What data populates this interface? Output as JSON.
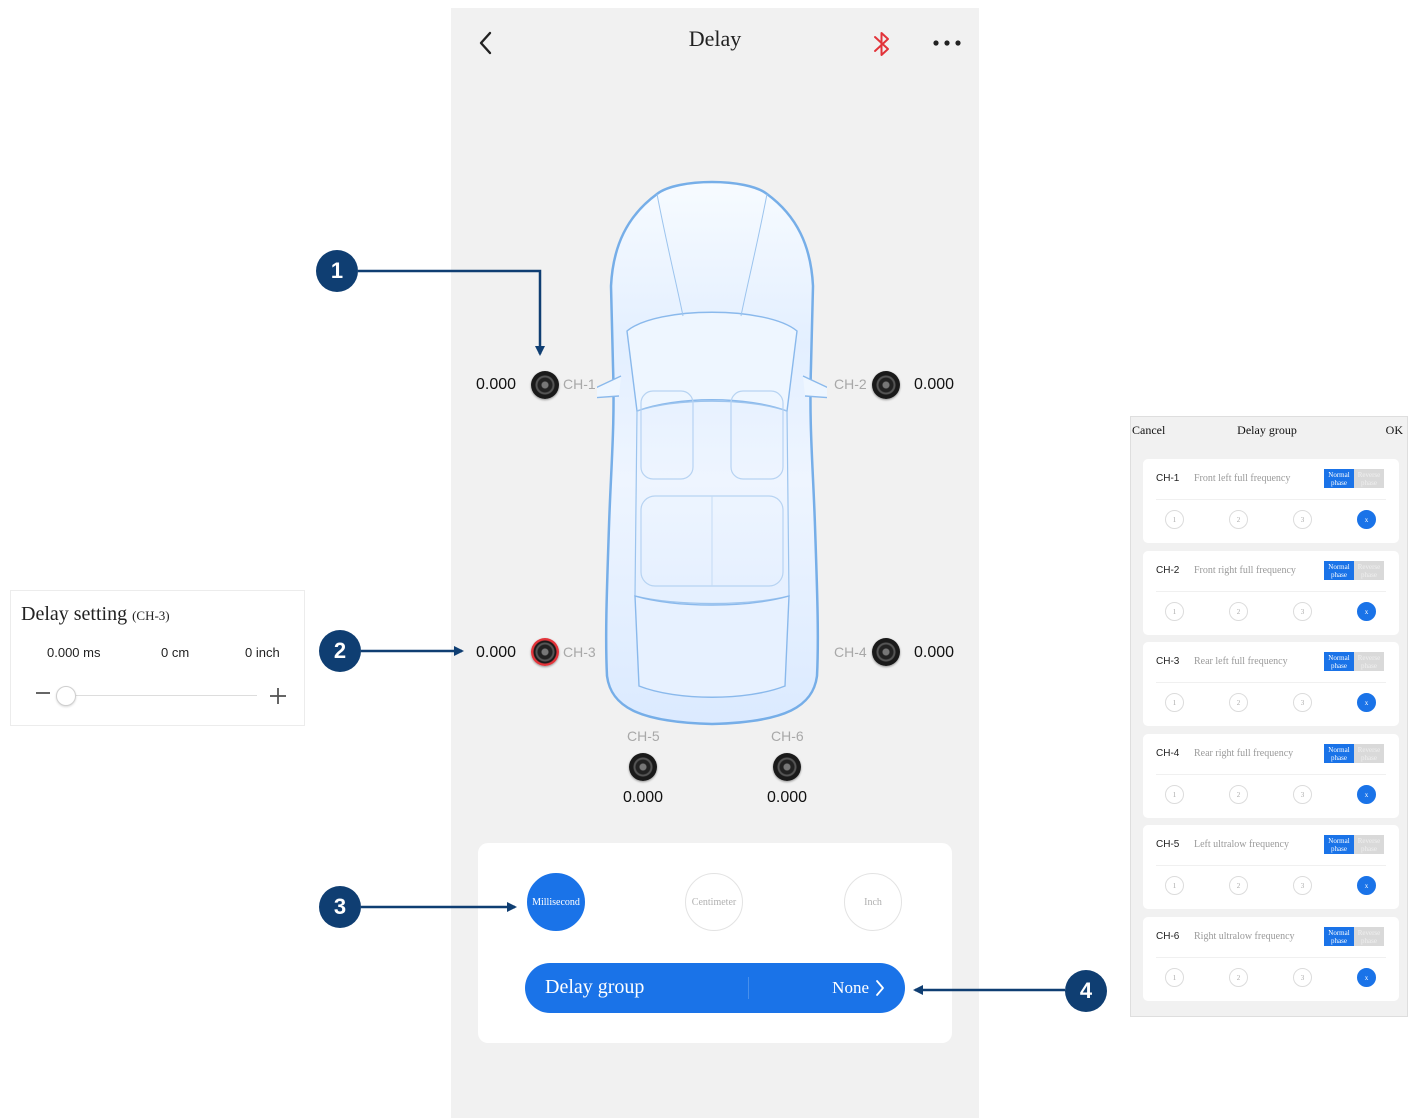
{
  "header": {
    "title": "Delay"
  },
  "icons": {
    "back": "chevron-left-icon",
    "bluetooth": "bluetooth-icon",
    "more": "more-dots-icon"
  },
  "colors": {
    "accent": "#1a73e8",
    "bluetooth": "#e2343a",
    "active_speaker_ring": "#e2343a",
    "callout": "#0f3e72"
  },
  "speakers": [
    {
      "id": "CH-1",
      "value": "0.000"
    },
    {
      "id": "CH-2",
      "value": "0.000"
    },
    {
      "id": "CH-3",
      "value": "0.000",
      "active": true
    },
    {
      "id": "CH-4",
      "value": "0.000"
    },
    {
      "id": "CH-5",
      "value": "0.000"
    },
    {
      "id": "CH-6",
      "value": "0.000"
    }
  ],
  "units": {
    "options": [
      "Millisecond",
      "Centimeter",
      "Inch"
    ],
    "selected": "Millisecond"
  },
  "delay_group": {
    "label": "Delay group",
    "value": "None"
  },
  "callouts": [
    "1",
    "2",
    "3",
    "4"
  ],
  "delay_setting": {
    "title": "Delay setting",
    "channel": "(CH-3)",
    "ms": "0.000 ms",
    "cm": "0 cm",
    "inch": "0 inch",
    "slider_fraction": 0
  },
  "dialog": {
    "cancel": "Cancel",
    "title": "Delay group",
    "ok": "OK",
    "normal_phase": "Normal phase",
    "reverse_phase": "Reverse phase",
    "options": [
      "1",
      "2",
      "3",
      "x"
    ],
    "selected_option": "x",
    "channels": [
      {
        "ch": "CH-1",
        "name": "Front left full frequency"
      },
      {
        "ch": "CH-2",
        "name": "Front right full frequency"
      },
      {
        "ch": "CH-3",
        "name": "Rear left full frequency"
      },
      {
        "ch": "CH-4",
        "name": "Rear right full frequency"
      },
      {
        "ch": "CH-5",
        "name": "Left ultralow frequency"
      },
      {
        "ch": "CH-6",
        "name": "Right ultralow frequency"
      }
    ]
  }
}
